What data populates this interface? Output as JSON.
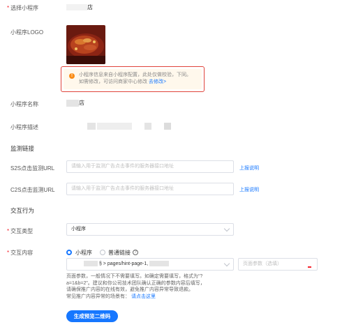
{
  "mini_program_select": {
    "label": "选择小程序",
    "value_suffix": "店"
  },
  "logo": {
    "label": "小程序LOGO"
  },
  "notice": {
    "line1": "小程序信息来自小程序配置，此处仅做校验，下同。",
    "line2_prefix": "如需修改，可访问商家中心修改",
    "link": "去修改>"
  },
  "mini_program_name": {
    "label": "小程序名称",
    "value_suffix": "店"
  },
  "mini_program_desc": {
    "label": "小程序描述"
  },
  "monitor": {
    "title": "监测链接",
    "s2s": {
      "label": "S2S点击监测URL",
      "placeholder": "请输入用于监测广告点击事件的服务器接口地址",
      "help": "上报说明"
    },
    "c2s": {
      "label": "C2S点击监测URL",
      "placeholder": "请输入用于监测广告点击事件的服务器接口地址",
      "help": "上报说明"
    }
  },
  "interaction": {
    "title": "交互行为",
    "type": {
      "label": "交互类型",
      "value": "小程序"
    },
    "content": {
      "label": "交互内容",
      "option_mini": "小程序",
      "option_link": "普通链接",
      "path_prefix": "§ > pages/hint-page-1,",
      "param_placeholder": "页面参数（选填）"
    },
    "desc": [
      "页面参数，一般情况下不需要填写。如确定需要填写，格式为“?",
      "a=1&b=2”。建议和你公司技术团队确认正确的参数内容后填写，",
      "请确保推广内容的在线有效，避免推广内容异常导致退款。",
      "常见推广内容异常的场景有："
    ],
    "desc_link": "请点击这里",
    "generate_button": "生成预览二维码"
  },
  "colors": {
    "primary": "#1677ff",
    "warning": "#fa8c16",
    "required": "#f5222d",
    "highlight_border": "#e0433b"
  }
}
